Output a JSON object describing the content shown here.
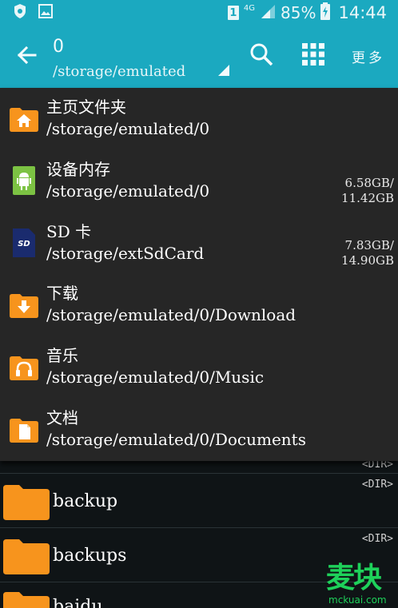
{
  "status_bar": {
    "sim": "1",
    "network": "4G",
    "battery": "85%",
    "time": "14:44",
    "icons": [
      "shield-icon",
      "image-icon",
      "signal-icon",
      "battery-charging-icon"
    ]
  },
  "app_bar": {
    "title": "0",
    "path": "/storage/emulated",
    "more_label": "更多",
    "icons": [
      "back-arrow-icon",
      "search-icon",
      "grid-view-icon",
      "dropdown-triangle-icon"
    ]
  },
  "dropdown": {
    "items": [
      {
        "name": "主页文件夹",
        "path": "/storage/emulated/0",
        "size_used": "",
        "size_total": "",
        "icon": "home-folder-icon"
      },
      {
        "name": "设备内存",
        "path": "/storage/emulated/0",
        "size_used": "6.58GB/",
        "size_total": "11.42GB",
        "icon": "android-storage-icon"
      },
      {
        "name": "SD 卡",
        "path": "/storage/extSdCard",
        "size_used": "7.83GB/",
        "size_total": "14.90GB",
        "icon": "sd-card-icon"
      },
      {
        "name": "下载",
        "path": "/storage/emulated/0/Download",
        "size_used": "",
        "size_total": "",
        "icon": "download-folder-icon"
      },
      {
        "name": "音乐",
        "path": "/storage/emulated/0/Music",
        "size_used": "",
        "size_total": "",
        "icon": "music-folder-icon"
      },
      {
        "name": "文档",
        "path": "/storage/emulated/0/Documents",
        "size_used": "",
        "size_total": "",
        "icon": "documents-folder-icon"
      }
    ]
  },
  "file_list": {
    "rows": [
      {
        "name": "",
        "tag": "<DIR>"
      },
      {
        "name": "backup",
        "tag": "<DIR>"
      },
      {
        "name": "backups",
        "tag": "<DIR>"
      },
      {
        "name": "baidu",
        "tag": ""
      }
    ]
  },
  "watermark": {
    "big": "麦块",
    "small": "mckuai.com"
  },
  "colors": {
    "accent": "#1ba9c0",
    "panel": "#262626",
    "background": "#0f1416",
    "folder": "#f7941d",
    "watermark": "#1ed15a"
  }
}
